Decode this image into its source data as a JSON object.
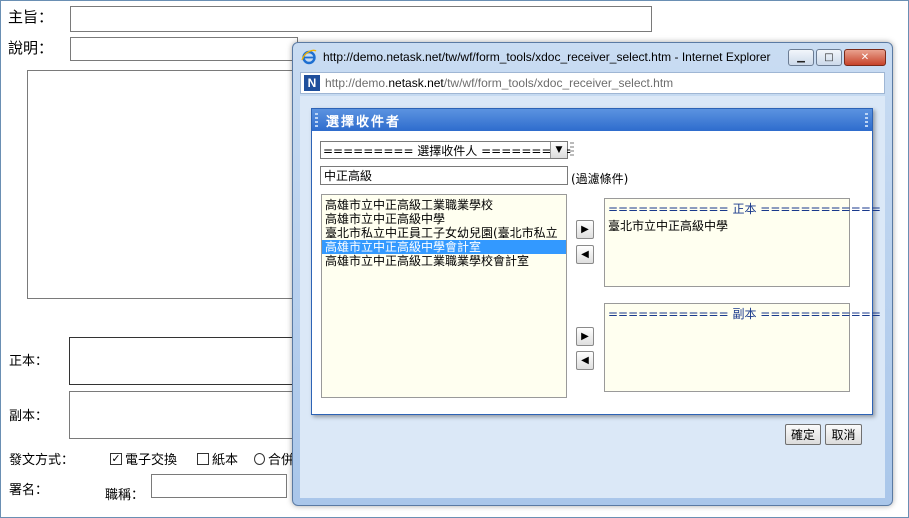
{
  "form": {
    "subject_label": "主旨：",
    "description_label": "說明：",
    "main_recipient_label": "正本：",
    "copy_recipient_label": "副本：",
    "send_method_label": "發文方式：",
    "send_options": {
      "electronic": "電子交換",
      "paper": "紙本",
      "other": "合併"
    },
    "sign_label": "署名：",
    "title_label": "職稱："
  },
  "browser": {
    "title": "http://demo.netask.net/tw/wf/form_tools/xdoc_receiver_select.htm - Internet Explorer",
    "address_prefix": "http://demo.",
    "address_domain": "netask.net",
    "address_path": "/tw/wf/form_tools/xdoc_receiver_select.htm",
    "address_icon": "N"
  },
  "dialog": {
    "title": "選擇收件者",
    "select_value": "========= 選擇收件人 =========",
    "filter_value": "中正高級",
    "filter_label": "(過濾條件)",
    "candidates": [
      "高雄市立中正高級工業職業學校",
      "高雄市立中正高級中學",
      "臺北市私立中正員工子女幼兒園(臺北市私立",
      "高雄市立中正高級中學會計室",
      "高雄市立中正高級工業職業學校會計室"
    ],
    "selected_index": 3,
    "main_header": "============ 正本 ============",
    "main_items": [
      "臺北市立中正高級中學"
    ],
    "copy_header": "============ 副本 ============",
    "ok_label": "確定",
    "cancel_label": "取消"
  },
  "icons": {
    "ie": "ie-logo-icon",
    "minimize": "minimize-icon",
    "maximize": "maximize-icon",
    "close": "close-icon",
    "arrow_right": "arrow-right-icon",
    "arrow_left": "arrow-left-icon",
    "dropdown": "chevron-down-icon"
  },
  "colors": {
    "dialog_header": "#2e6ccd",
    "selected_item": "#3399ff",
    "list_background": "#fffff0"
  }
}
